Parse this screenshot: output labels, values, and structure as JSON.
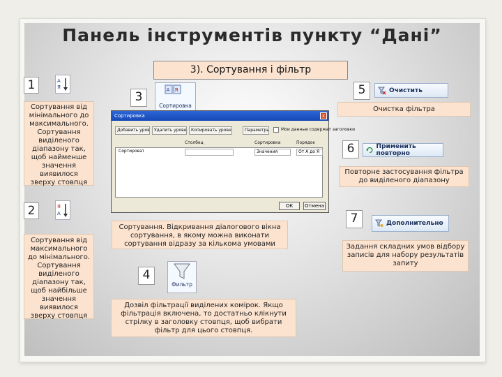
{
  "title": "Панель інструментів пункту “Дані”",
  "subtitle": "3). Сортування і фільтр",
  "items": {
    "n1": "1",
    "n2": "2",
    "n3": "3",
    "n4": "4",
    "n5": "5",
    "n6": "6",
    "n7": "7",
    "sort_asc_desc": "Сортування від мінімального до максимального. Сортування виділеного діапазону так, щоб найменше значення виявилося зверху стовпця",
    "sort_desc_desc": "Сортування від максимального до мінімального. Сортування виділеного діапазону так, щоб найбільше значення виявилося зверху стовпця",
    "sort_btn_label": "Сортировка",
    "sort_desc": "Сортування. Відкривання діалогового вікна сортування, в якому можна виконати сортування відразу за кількома умовами",
    "filter_btn_label": "Фильтр",
    "filter_desc": "Дозвіл фільтрації виділених комірок. Якщо фільтрація включена, то достатньо клікнути стрілку в заголовку стовпця, щоб вибрати фільтр для цього стовпця.",
    "clear_btn_label": "Очистить",
    "clear_desc": "Очистка фільтра",
    "reapply_btn_label": "Применить повторно",
    "reapply_desc": "Повторне застосування фільтра до виділеного діапазону",
    "advanced_btn_label": "Дополнительно",
    "advanced_desc": "Задання складних умов відбору записів для набору результатів запиту"
  },
  "dialog": {
    "title": "Сортировка",
    "close": "x",
    "toolbar": [
      "Добавить уровень",
      "Удалить уровень",
      "Копировать уровень",
      "Параметры..."
    ],
    "checkbox_label": "Мои данные содержат заголовки",
    "col_headers": [
      "Столбец",
      "Сортировка",
      "Порядок"
    ],
    "row": [
      "Сортировать по",
      "Значения",
      "От А до Я"
    ],
    "ok": "ОК",
    "cancel": "Отмена"
  },
  "colors": {
    "box_fill": "#fce3cf",
    "accent_blue": "#1648b5"
  }
}
